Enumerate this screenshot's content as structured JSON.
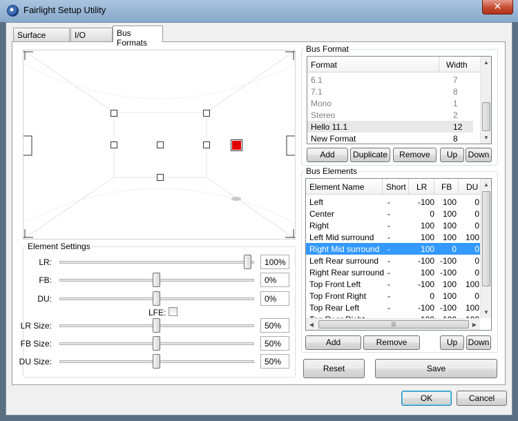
{
  "window": {
    "title": "Fairlight Setup Utility",
    "close_glyph": "✕"
  },
  "tabs": [
    {
      "label": "Surface Config"
    },
    {
      "label": "I/O Config"
    },
    {
      "label": "Bus Formats"
    }
  ],
  "active_tab": "Bus Formats",
  "bus_format": {
    "title": "Bus Format",
    "columns": {
      "format": "Format",
      "width": "Width"
    },
    "rows": [
      {
        "format": "6.1",
        "width": "7"
      },
      {
        "format": "7.1",
        "width": "8"
      },
      {
        "format": "Mono",
        "width": "1"
      },
      {
        "format": "Stereo",
        "width": "2"
      },
      {
        "format": "Hello 11.1",
        "width": "12"
      },
      {
        "format": "New Format",
        "width": "8"
      }
    ],
    "buttons": {
      "add": "Add",
      "duplicate": "Duplicate",
      "remove": "Remove",
      "up": "Up",
      "down": "Down"
    }
  },
  "bus_elements": {
    "title": "Bus Elements",
    "columns": {
      "name": "Element Name",
      "short": "Short",
      "lr": "LR",
      "fb": "FB",
      "du": "DU"
    },
    "rows": [
      {
        "name": "Left",
        "short": "-",
        "lr": "-100",
        "fb": "100",
        "du": "0"
      },
      {
        "name": "Center",
        "short": "-",
        "lr": "0",
        "fb": "100",
        "du": "0"
      },
      {
        "name": "Right",
        "short": "-",
        "lr": "100",
        "fb": "100",
        "du": "0"
      },
      {
        "name": "Left Mid surround",
        "short": "-",
        "lr": "100",
        "fb": "100",
        "du": "100"
      },
      {
        "name": "Right Mid surround",
        "short": "-",
        "lr": "100",
        "fb": "0",
        "du": "0"
      },
      {
        "name": "Left Rear surround",
        "short": "-",
        "lr": "-100",
        "fb": "-100",
        "du": "0"
      },
      {
        "name": "Right Rear surround",
        "short": "-",
        "lr": "100",
        "fb": "-100",
        "du": "0"
      },
      {
        "name": "Top Front Left",
        "short": "-",
        "lr": "-100",
        "fb": "100",
        "du": "100"
      },
      {
        "name": "Top Front Right",
        "short": "-",
        "lr": "0",
        "fb": "100",
        "du": "0"
      },
      {
        "name": "Top Rear Left",
        "short": "-",
        "lr": "-100",
        "fb": "-100",
        "du": "100"
      },
      {
        "name": "Top Rear Right",
        "short": "-",
        "lr": "100",
        "fb": "-100",
        "du": "100"
      }
    ],
    "selected": "Right Mid surround",
    "buttons": {
      "add": "Add",
      "remove": "Remove",
      "up": "Up",
      "down": "Down"
    }
  },
  "element_settings": {
    "title": "Element Settings",
    "lr": {
      "label": "LR:",
      "value": "100%",
      "fraction": 1.0
    },
    "fb": {
      "label": "FB:",
      "value": "0%",
      "fraction": 0.5
    },
    "du": {
      "label": "DU:",
      "value": "0%",
      "fraction": 0.5
    },
    "lfe": {
      "label": "LFE:",
      "checked": false
    },
    "lr_size": {
      "label": "LR Size:",
      "value": "50%",
      "fraction": 0.5
    },
    "fb_size": {
      "label": "FB Size:",
      "value": "50%",
      "fraction": 0.5
    },
    "du_size": {
      "label": "DU Size:",
      "value": "50%",
      "fraction": 0.5
    }
  },
  "actions": {
    "reset": "Reset",
    "save": "Save"
  },
  "dialog": {
    "ok": "OK",
    "cancel": "Cancel"
  },
  "colors": {
    "selection": "#3399ff",
    "active_element": "#e00000",
    "title_bar": "#9ab8d8"
  }
}
